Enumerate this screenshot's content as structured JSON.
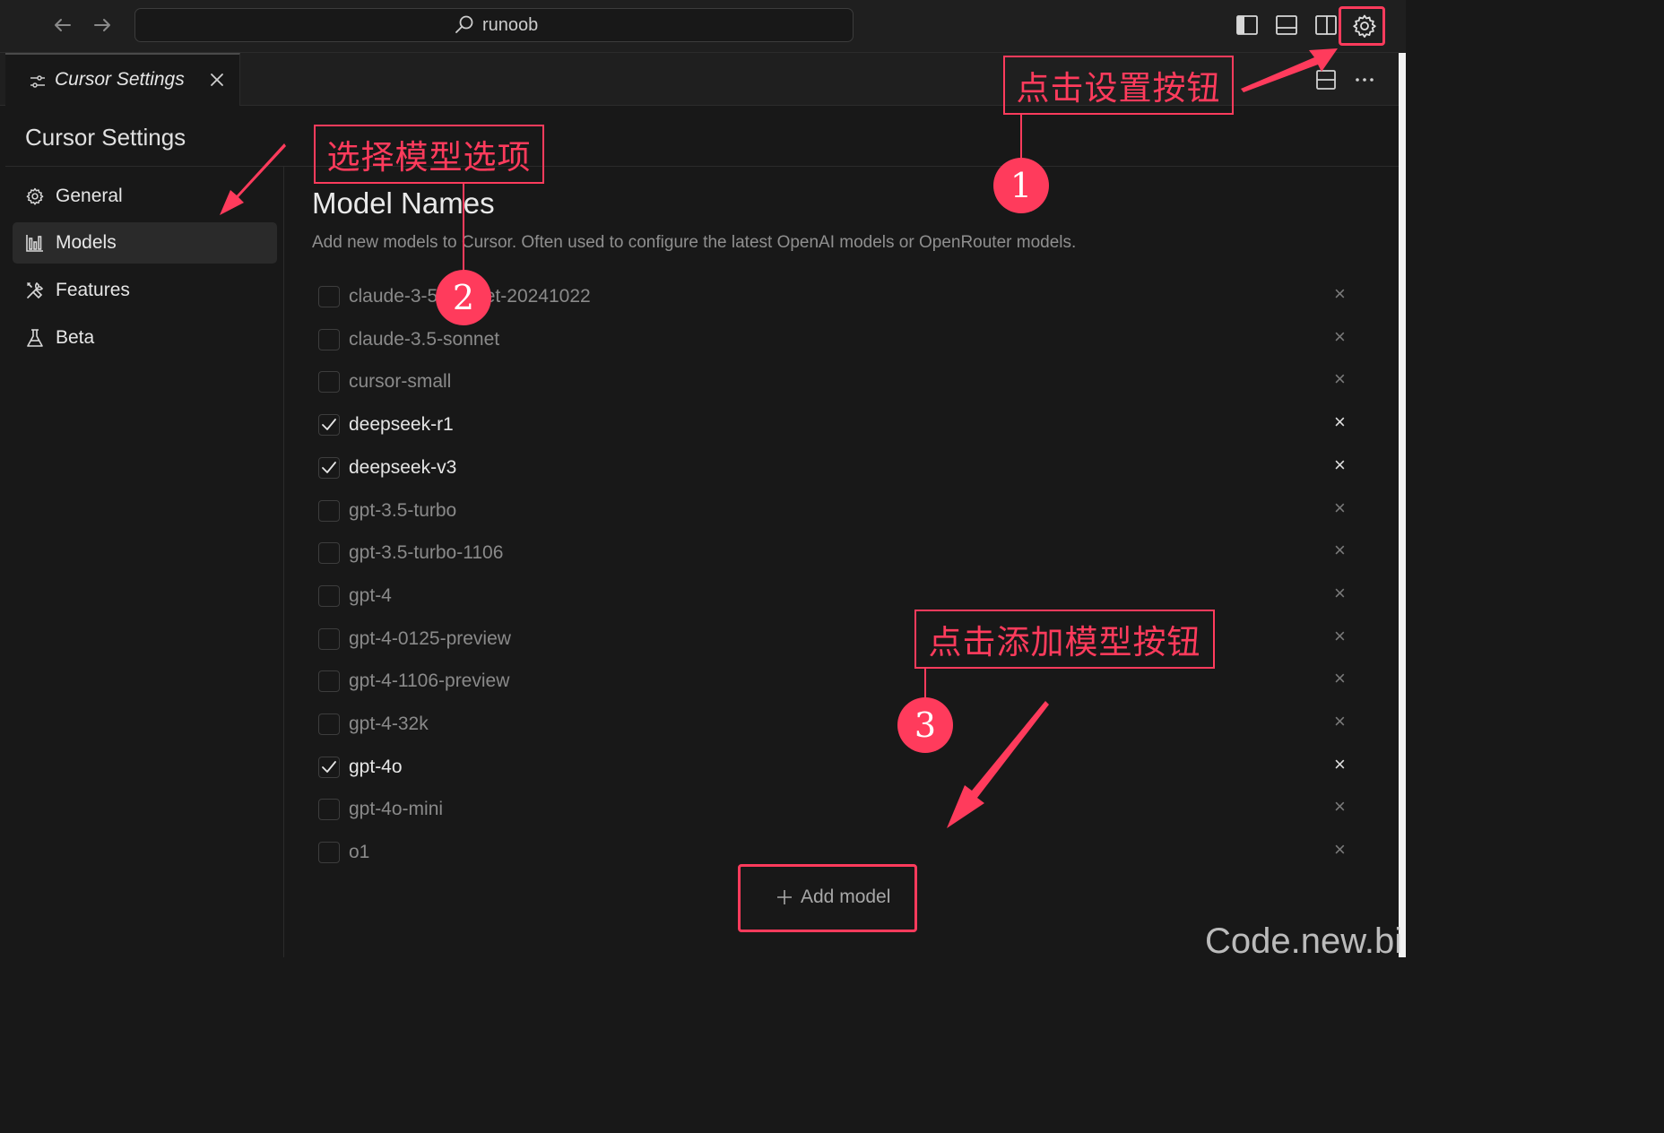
{
  "titlebar": {
    "back_icon": "arrow-left-icon",
    "forward_icon": "arrow-right-icon",
    "search_text": "runoob",
    "layout_icons": [
      "toggle-primary-sidebar-icon",
      "toggle-panel-icon",
      "toggle-secondary-sidebar-icon",
      "gear-icon"
    ]
  },
  "tab": {
    "label": "Cursor Settings",
    "icon": "settings-sliders-icon"
  },
  "tab_actions": [
    "split-editor-icon",
    "more-actions-icon"
  ],
  "sidebar": {
    "title": "Cursor Settings",
    "items": [
      {
        "label": "General",
        "icon": "gear-icon",
        "active": false
      },
      {
        "label": "Models",
        "icon": "bar-chart-icon",
        "active": true
      },
      {
        "label": "Features",
        "icon": "tools-icon",
        "active": false
      },
      {
        "label": "Beta",
        "icon": "flask-icon",
        "active": false
      }
    ]
  },
  "main": {
    "title": "Model Names",
    "description": "Add new models to Cursor. Often used to configure the latest OpenAI models or OpenRouter models.",
    "models": [
      {
        "name": "claude-3-5-sonnet-20241022",
        "checked": false
      },
      {
        "name": "claude-3.5-sonnet",
        "checked": false
      },
      {
        "name": "cursor-small",
        "checked": false
      },
      {
        "name": "deepseek-r1",
        "checked": true
      },
      {
        "name": "deepseek-v3",
        "checked": true
      },
      {
        "name": "gpt-3.5-turbo",
        "checked": false
      },
      {
        "name": "gpt-3.5-turbo-1106",
        "checked": false
      },
      {
        "name": "gpt-4",
        "checked": false
      },
      {
        "name": "gpt-4-0125-preview",
        "checked": false
      },
      {
        "name": "gpt-4-1106-preview",
        "checked": false
      },
      {
        "name": "gpt-4-32k",
        "checked": false
      },
      {
        "name": "gpt-4o",
        "checked": true
      },
      {
        "name": "gpt-4o-mini",
        "checked": false
      },
      {
        "name": "o1",
        "checked": false
      }
    ],
    "remove_symbol": "×",
    "add_button_label": "Add model"
  },
  "annotations": {
    "step1_text": "点击设置按钮",
    "step1_number": "1",
    "step2_text": "选择模型选项",
    "step2_number": "2",
    "step3_text": "点击添加模型按钮",
    "step3_number": "3",
    "color": "#ff3b5c"
  },
  "watermark": "Code.new.bi"
}
